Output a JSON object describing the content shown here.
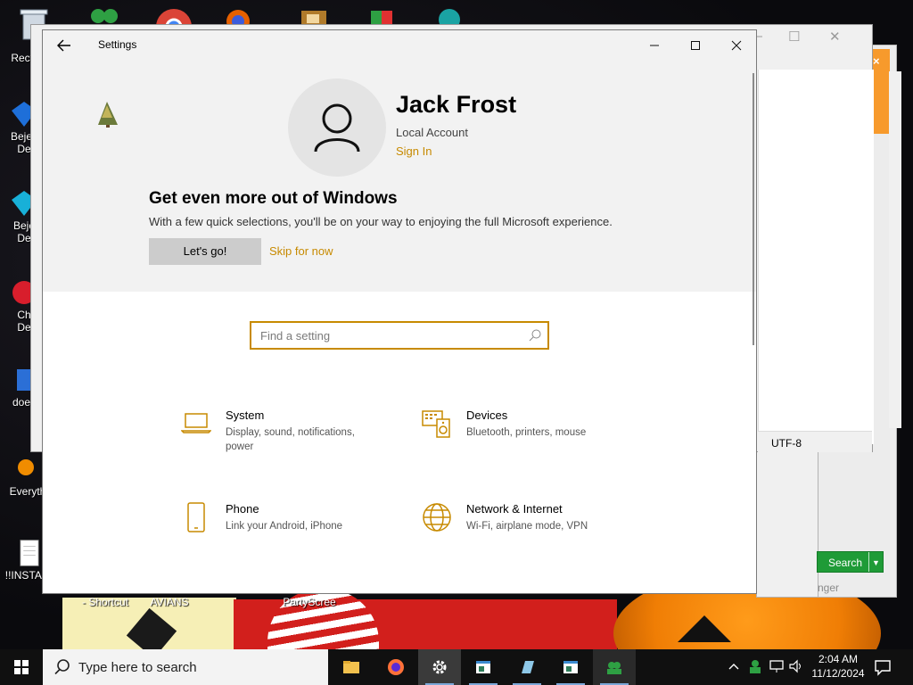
{
  "desktop": {
    "icons": [
      {
        "label": "Recy"
      },
      {
        "label": "Bejev\nDe"
      },
      {
        "label": "Beje\nDe"
      },
      {
        "label": "Ch\nDe"
      },
      {
        "label": "does"
      },
      {
        "label": "Everyth"
      },
      {
        "label": "!!INSTALL"
      }
    ],
    "bottom_labels": [
      "- Shortcut",
      "AVIANS",
      "PartyScree"
    ]
  },
  "background_window": {
    "status_encoding": "UTF-8",
    "search_button": "Search",
    "partial_text": "nger"
  },
  "settings": {
    "title": "Settings",
    "user": {
      "name": "Jack Frost",
      "account_type": "Local Account",
      "sign_in": "Sign In"
    },
    "promo": {
      "heading": "Get even more out of Windows",
      "body": "With a few quick selections, you'll be on your way to enjoying the full Microsoft experience.",
      "primary_button": "Let's go!",
      "secondary_link": "Skip for now"
    },
    "search": {
      "placeholder": "Find a setting",
      "value": ""
    },
    "categories": [
      {
        "title": "System",
        "desc": "Display, sound, notifications, power",
        "icon": "laptop-icon"
      },
      {
        "title": "Devices",
        "desc": "Bluetooth, printers, mouse",
        "icon": "keyboard-speaker-icon"
      },
      {
        "title": "Phone",
        "desc": "Link your Android, iPhone",
        "icon": "phone-icon"
      },
      {
        "title": "Network & Internet",
        "desc": "Wi-Fi, airplane mode, VPN",
        "icon": "globe-icon"
      }
    ],
    "accent_color": "#c78a00"
  },
  "taskbar": {
    "search_placeholder": "Type here to search",
    "time": "2:04 AM",
    "date": "11/12/2024"
  }
}
